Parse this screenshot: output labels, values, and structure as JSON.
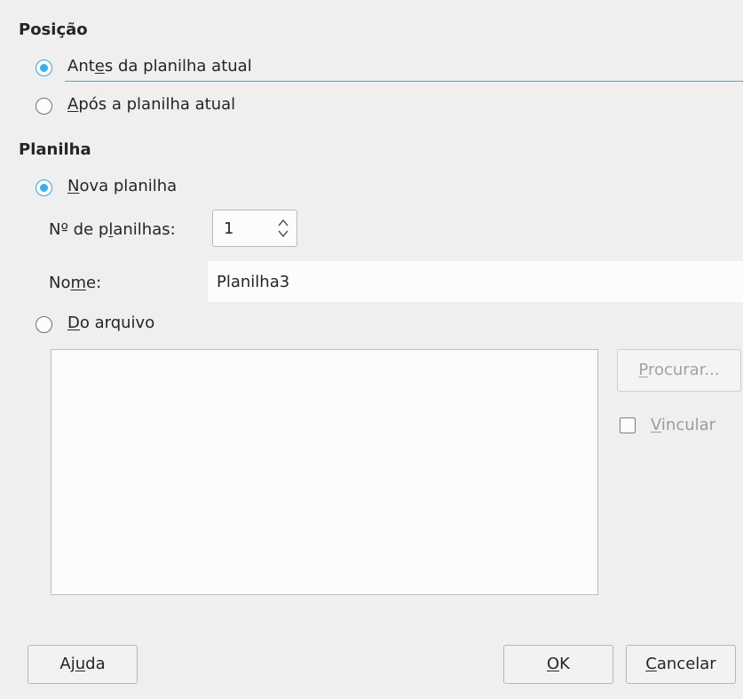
{
  "position": {
    "title": "Posição",
    "before_label": "Antes da planilha atual",
    "after_label": "Após a planilha atual",
    "selected": "before"
  },
  "sheet": {
    "title": "Planilha",
    "new_label": "Nova planilha",
    "count_label": "Nº de planilhas:",
    "count_value": "1",
    "name_label": "Nome:",
    "name_value": "Planilha3",
    "from_file_label": "Do arquivo",
    "selected": "new"
  },
  "file": {
    "browse_label": "Procurar...",
    "link_label": "Vincular",
    "link_checked": false
  },
  "buttons": {
    "help_label": "Ajuda",
    "ok_label": "OK",
    "cancel_label": "Cancelar"
  },
  "icons": {
    "spin_up": "chevron-up-icon",
    "spin_down": "chevron-down-icon"
  },
  "colors": {
    "accent": "#3daee9",
    "background": "#efefef",
    "field": "#fcfcfc"
  }
}
